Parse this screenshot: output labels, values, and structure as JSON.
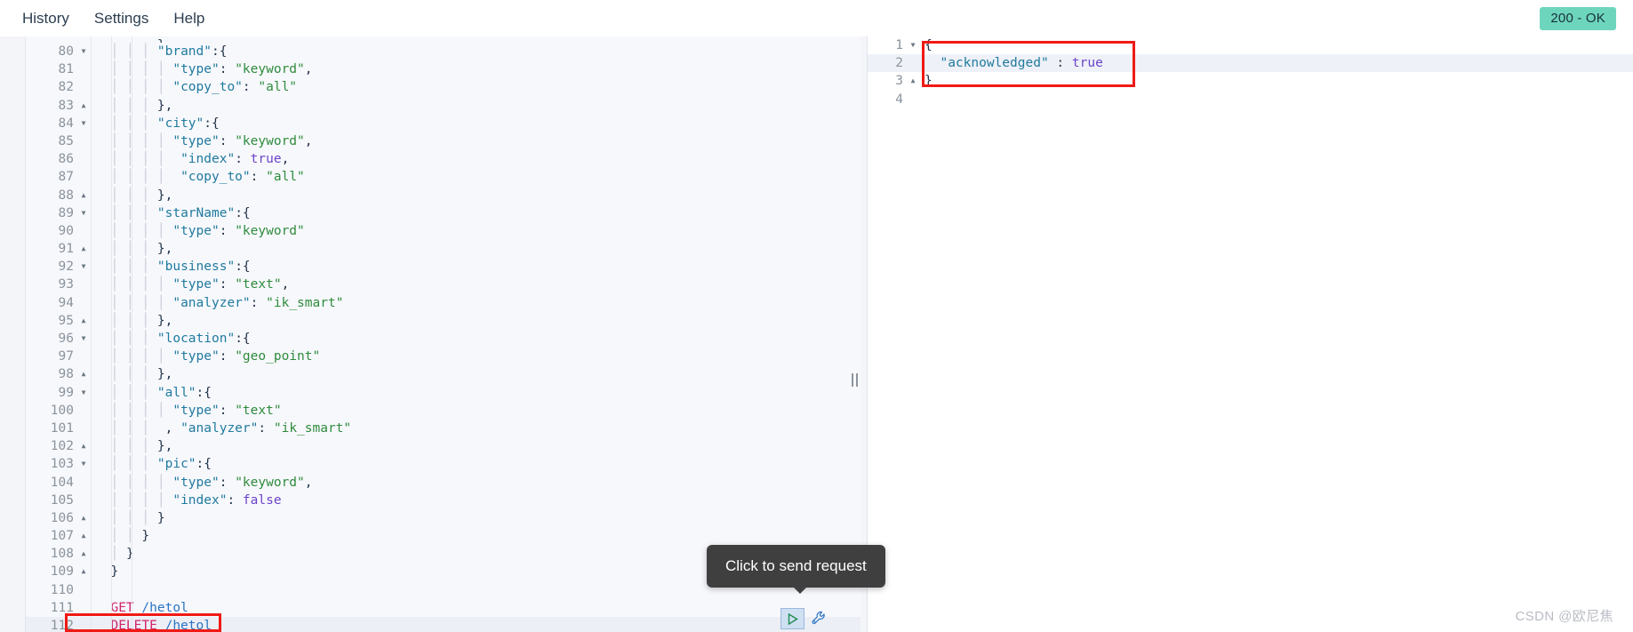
{
  "menu": {
    "items": [
      {
        "label": "History",
        "name": "menu-history"
      },
      {
        "label": "Settings",
        "name": "menu-settings"
      },
      {
        "label": "Help",
        "name": "menu-help"
      }
    ]
  },
  "status": {
    "badge": "200 - OK",
    "badge_bg": "#6ed5bd",
    "badge_fg": "#16313a"
  },
  "editor": {
    "lines": [
      {
        "num": "80",
        "fold": "▼",
        "indent": "        ",
        "tokens": [
          {
            "t": "\"brand\"",
            "c": "k"
          },
          {
            "t": ":{",
            "c": "p"
          }
        ]
      },
      {
        "num": "81",
        "fold": "",
        "indent": "          ",
        "tokens": [
          {
            "t": "\"type\"",
            "c": "k"
          },
          {
            "t": ": ",
            "c": "p"
          },
          {
            "t": "\"keyword\"",
            "c": "s"
          },
          {
            "t": ",",
            "c": "p"
          }
        ]
      },
      {
        "num": "82",
        "fold": "",
        "indent": "          ",
        "tokens": [
          {
            "t": "\"copy_to\"",
            "c": "k"
          },
          {
            "t": ": ",
            "c": "p"
          },
          {
            "t": "\"all\"",
            "c": "s"
          }
        ]
      },
      {
        "num": "83",
        "fold": "▲",
        "indent": "        ",
        "tokens": [
          {
            "t": "},",
            "c": "p"
          }
        ]
      },
      {
        "num": "84",
        "fold": "▼",
        "indent": "        ",
        "tokens": [
          {
            "t": "\"city\"",
            "c": "k"
          },
          {
            "t": ":{",
            "c": "p"
          }
        ]
      },
      {
        "num": "85",
        "fold": "",
        "indent": "          ",
        "tokens": [
          {
            "t": "\"type\"",
            "c": "k"
          },
          {
            "t": ": ",
            "c": "p"
          },
          {
            "t": "\"keyword\"",
            "c": "s"
          },
          {
            "t": ",",
            "c": "p"
          }
        ]
      },
      {
        "num": "86",
        "fold": "",
        "indent": "           ",
        "tokens": [
          {
            "t": "\"index\"",
            "c": "k"
          },
          {
            "t": ": ",
            "c": "p"
          },
          {
            "t": "true",
            "c": "b"
          },
          {
            "t": ",",
            "c": "p"
          }
        ]
      },
      {
        "num": "87",
        "fold": "",
        "indent": "           ",
        "tokens": [
          {
            "t": "\"copy_to\"",
            "c": "k"
          },
          {
            "t": ": ",
            "c": "p"
          },
          {
            "t": "\"all\"",
            "c": "s"
          }
        ]
      },
      {
        "num": "88",
        "fold": "▲",
        "indent": "        ",
        "tokens": [
          {
            "t": "},",
            "c": "p"
          }
        ]
      },
      {
        "num": "89",
        "fold": "▼",
        "indent": "        ",
        "tokens": [
          {
            "t": "\"starName\"",
            "c": "k"
          },
          {
            "t": ":{",
            "c": "p"
          }
        ]
      },
      {
        "num": "90",
        "fold": "",
        "indent": "          ",
        "tokens": [
          {
            "t": "\"type\"",
            "c": "k"
          },
          {
            "t": ": ",
            "c": "p"
          },
          {
            "t": "\"keyword\"",
            "c": "s"
          }
        ]
      },
      {
        "num": "91",
        "fold": "▲",
        "indent": "        ",
        "tokens": [
          {
            "t": "},",
            "c": "p"
          }
        ]
      },
      {
        "num": "92",
        "fold": "▼",
        "indent": "        ",
        "tokens": [
          {
            "t": "\"business\"",
            "c": "k"
          },
          {
            "t": ":{",
            "c": "p"
          }
        ]
      },
      {
        "num": "93",
        "fold": "",
        "indent": "          ",
        "tokens": [
          {
            "t": "\"type\"",
            "c": "k"
          },
          {
            "t": ": ",
            "c": "p"
          },
          {
            "t": "\"text\"",
            "c": "s"
          },
          {
            "t": ",",
            "c": "p"
          }
        ]
      },
      {
        "num": "94",
        "fold": "",
        "indent": "          ",
        "tokens": [
          {
            "t": "\"analyzer\"",
            "c": "k"
          },
          {
            "t": ": ",
            "c": "p"
          },
          {
            "t": "\"ik_smart\"",
            "c": "s"
          }
        ]
      },
      {
        "num": "95",
        "fold": "▲",
        "indent": "        ",
        "tokens": [
          {
            "t": "},",
            "c": "p"
          }
        ]
      },
      {
        "num": "96",
        "fold": "▼",
        "indent": "        ",
        "tokens": [
          {
            "t": "\"location\"",
            "c": "k"
          },
          {
            "t": ":{",
            "c": "p"
          }
        ]
      },
      {
        "num": "97",
        "fold": "",
        "indent": "          ",
        "tokens": [
          {
            "t": "\"type\"",
            "c": "k"
          },
          {
            "t": ": ",
            "c": "p"
          },
          {
            "t": "\"geo_point\"",
            "c": "s"
          }
        ]
      },
      {
        "num": "98",
        "fold": "▲",
        "indent": "        ",
        "tokens": [
          {
            "t": "},",
            "c": "p"
          }
        ]
      },
      {
        "num": "99",
        "fold": "▼",
        "indent": "        ",
        "tokens": [
          {
            "t": "\"all\"",
            "c": "k"
          },
          {
            "t": ":{",
            "c": "p"
          }
        ]
      },
      {
        "num": "100",
        "fold": "",
        "indent": "          ",
        "tokens": [
          {
            "t": "\"type\"",
            "c": "k"
          },
          {
            "t": ": ",
            "c": "p"
          },
          {
            "t": "\"text\"",
            "c": "s"
          }
        ]
      },
      {
        "num": "101",
        "fold": "",
        "indent": "         ",
        "tokens": [
          {
            "t": ", ",
            "c": "p"
          },
          {
            "t": "\"analyzer\"",
            "c": "k"
          },
          {
            "t": ": ",
            "c": "p"
          },
          {
            "t": "\"ik_smart\"",
            "c": "s"
          }
        ]
      },
      {
        "num": "102",
        "fold": "▲",
        "indent": "        ",
        "tokens": [
          {
            "t": "},",
            "c": "p"
          }
        ]
      },
      {
        "num": "103",
        "fold": "▼",
        "indent": "        ",
        "tokens": [
          {
            "t": "\"pic\"",
            "c": "k"
          },
          {
            "t": ":{",
            "c": "p"
          }
        ]
      },
      {
        "num": "104",
        "fold": "",
        "indent": "          ",
        "tokens": [
          {
            "t": "\"type\"",
            "c": "k"
          },
          {
            "t": ": ",
            "c": "p"
          },
          {
            "t": "\"keyword\"",
            "c": "s"
          },
          {
            "t": ",",
            "c": "p"
          }
        ]
      },
      {
        "num": "105",
        "fold": "",
        "indent": "          ",
        "tokens": [
          {
            "t": "\"index\"",
            "c": "k"
          },
          {
            "t": ": ",
            "c": "p"
          },
          {
            "t": "false",
            "c": "b"
          }
        ]
      },
      {
        "num": "106",
        "fold": "▲",
        "indent": "        ",
        "tokens": [
          {
            "t": "}",
            "c": "p"
          }
        ]
      },
      {
        "num": "107",
        "fold": "▲",
        "indent": "      ",
        "tokens": [
          {
            "t": "}",
            "c": "p"
          }
        ]
      },
      {
        "num": "108",
        "fold": "▲",
        "indent": "    ",
        "tokens": [
          {
            "t": "}",
            "c": "p"
          }
        ]
      },
      {
        "num": "109",
        "fold": "▲",
        "indent": "  ",
        "tokens": [
          {
            "t": "}",
            "c": "p"
          }
        ]
      },
      {
        "num": "110",
        "fold": "",
        "indent": "",
        "tokens": []
      },
      {
        "num": "111",
        "fold": "",
        "indent": "  ",
        "tokens": [
          {
            "t": "GET",
            "c": "verb"
          },
          {
            "t": " ",
            "c": "p"
          },
          {
            "t": "/hetol",
            "c": "path"
          }
        ]
      },
      {
        "num": "112",
        "fold": "",
        "indent": "  ",
        "active": true,
        "tokens": [
          {
            "t": "DELETE",
            "c": "verb"
          },
          {
            "t": " ",
            "c": "p"
          },
          {
            "t": "/hetol",
            "c": "path"
          }
        ]
      }
    ],
    "partial_top_line": "},"
  },
  "response": {
    "lines": [
      {
        "num": "1",
        "fold": "▼",
        "indent": "",
        "tokens": [
          {
            "t": "{",
            "c": "p"
          }
        ]
      },
      {
        "num": "2",
        "fold": "",
        "indent": "  ",
        "active": true,
        "tokens": [
          {
            "t": "\"acknowledged\"",
            "c": "k"
          },
          {
            "t": " : ",
            "c": "p"
          },
          {
            "t": "true",
            "c": "b"
          }
        ]
      },
      {
        "num": "3",
        "fold": "▲",
        "indent": "",
        "tokens": [
          {
            "t": "}",
            "c": "p"
          }
        ]
      },
      {
        "num": "4",
        "fold": "",
        "indent": "",
        "tokens": []
      }
    ]
  },
  "tooltip": {
    "text": "Click to send request"
  },
  "actions": {
    "send_label": "send-request",
    "wrench_label": "auto-indent"
  },
  "watermark": {
    "text": "CSDN @欧尼焦"
  }
}
